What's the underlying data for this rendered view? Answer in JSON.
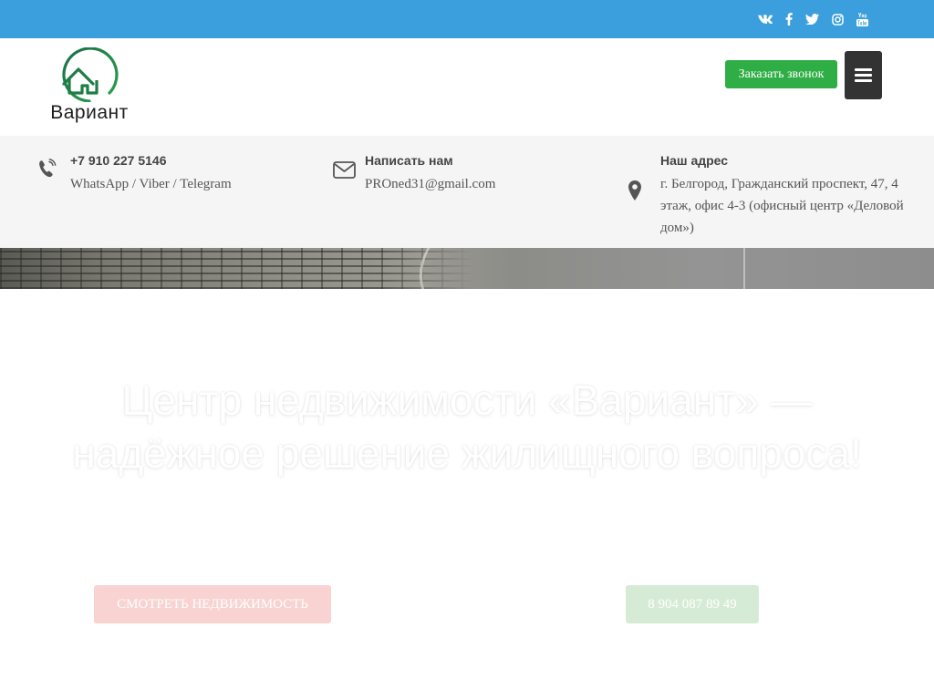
{
  "colors": {
    "topbar": "#3a9fdc",
    "callback_button": "#2eae45",
    "menu_button": "#333333",
    "brand_green": "#1f8a3f",
    "contact_bar": "#f5f5f5",
    "view_button": "#f9d3d1",
    "phone_button": "#d6ebd6"
  },
  "social": [
    {
      "icon": "vk-icon"
    },
    {
      "icon": "facebook-icon"
    },
    {
      "icon": "twitter-icon"
    },
    {
      "icon": "instagram-icon"
    },
    {
      "icon": "youtube-icon"
    }
  ],
  "header": {
    "logo_text": "Вариант",
    "callback_label": "Заказать звонок",
    "menu_icon": "hamburger-icon"
  },
  "contacts": {
    "phone": {
      "icon": "phone-icon",
      "title": "+7 910 227 5146",
      "text": "WhatsApp / Viber / Telegram"
    },
    "email": {
      "icon": "envelope-icon",
      "title": "Написать нам",
      "text": "PROned31@gmail.com"
    },
    "address": {
      "icon": "map-marker-icon",
      "title": "Наш адрес",
      "lines": [
        "г. Белгород, Гражданский проспект, 47, 4",
        "этаж, офис 4-3 (офисный центр «Деловой",
        "дом»)"
      ]
    }
  },
  "hero": {
    "title_line1": "Центр недвижимости «Вариант» —",
    "title_line2": "надёжное решение жилищного вопроса!",
    "view_button": "Смотреть недвижимость",
    "phone_button": "8 904 087 89 49"
  }
}
